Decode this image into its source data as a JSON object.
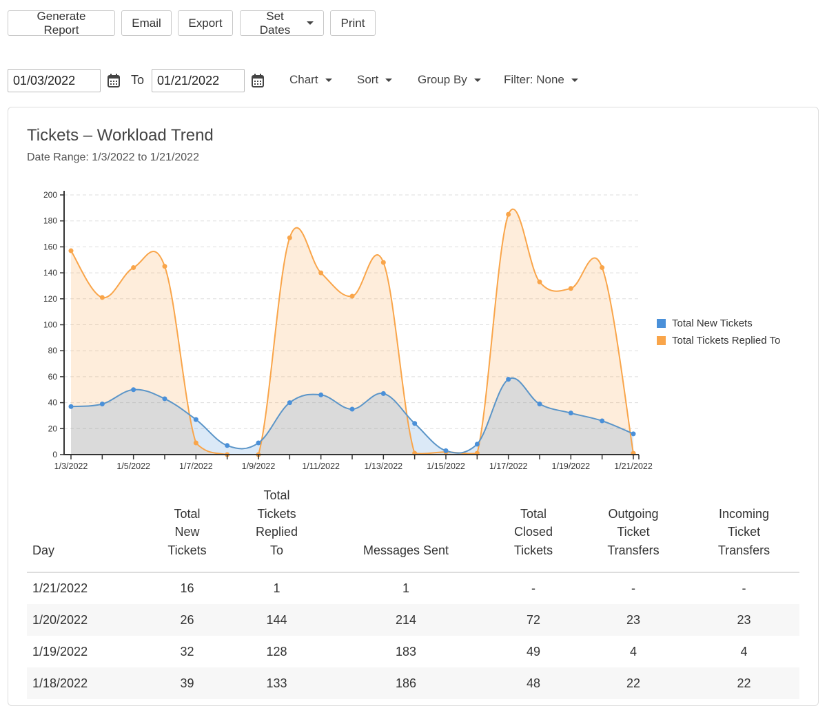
{
  "toolbar": {
    "generate_report": "Generate Report",
    "email": "Email",
    "export": "Export",
    "set_dates": "Set Dates",
    "print": "Print"
  },
  "filters": {
    "from_date": "01/03/2022",
    "to_label": "To",
    "to_date": "01/21/2022",
    "chart": "Chart",
    "sort": "Sort",
    "group_by": "Group By",
    "filter": "Filter: None"
  },
  "report": {
    "title": "Tickets – Workload Trend",
    "date_range": "Date Range: 1/3/2022 to 1/21/2022"
  },
  "chart_data": {
    "type": "area",
    "title": "Tickets – Workload Trend",
    "xlabel": "",
    "ylabel": "",
    "ylim": [
      0,
      200
    ],
    "yticks": [
      0,
      20,
      40,
      60,
      80,
      100,
      120,
      140,
      160,
      180,
      200
    ],
    "grid": true,
    "legend_position": "right",
    "x": [
      "1/3/2022",
      "1/4/2022",
      "1/5/2022",
      "1/6/2022",
      "1/7/2022",
      "1/8/2022",
      "1/9/2022",
      "1/10/2022",
      "1/11/2022",
      "1/12/2022",
      "1/13/2022",
      "1/14/2022",
      "1/15/2022",
      "1/16/2022",
      "1/17/2022",
      "1/18/2022",
      "1/19/2022",
      "1/20/2022",
      "1/21/2022"
    ],
    "xtick_labels": [
      "1/3/2022",
      "",
      "1/5/2022",
      "",
      "1/7/2022",
      "",
      "1/9/2022",
      "",
      "1/11/2022",
      "",
      "1/13/2022",
      "",
      "1/15/2022",
      "",
      "1/17/2022",
      "",
      "1/19/2022",
      "",
      "1/21/2022"
    ],
    "series": [
      {
        "name": "Total New Tickets",
        "color": "#4a90d9",
        "values": [
          37,
          39,
          50,
          43,
          27,
          7,
          9,
          40,
          46,
          35,
          47,
          24,
          3,
          8,
          58,
          39,
          32,
          26,
          16
        ]
      },
      {
        "name": "Total Tickets Replied To",
        "color": "#f9a54a",
        "values": [
          157,
          121,
          144,
          145,
          9,
          0,
          0,
          167,
          140,
          122,
          148,
          1,
          2,
          1,
          185,
          133,
          128,
          144,
          1
        ]
      }
    ]
  },
  "table": {
    "headers": [
      [
        "Day"
      ],
      [
        "Total",
        "New",
        "Tickets"
      ],
      [
        "Total",
        "Tickets",
        "Replied",
        "To"
      ],
      [
        "Messages Sent"
      ],
      [
        "Total",
        "Closed",
        "Tickets"
      ],
      [
        "Outgoing",
        "Ticket",
        "Transfers"
      ],
      [
        "Incoming",
        "Ticket",
        "Transfers"
      ]
    ],
    "rows": [
      [
        "1/21/2022",
        "16",
        "1",
        "1",
        "-",
        "-",
        "-"
      ],
      [
        "1/20/2022",
        "26",
        "144",
        "214",
        "72",
        "23",
        "23"
      ],
      [
        "1/19/2022",
        "32",
        "128",
        "183",
        "49",
        "4",
        "4"
      ],
      [
        "1/18/2022",
        "39",
        "133",
        "186",
        "48",
        "22",
        "22"
      ]
    ]
  }
}
